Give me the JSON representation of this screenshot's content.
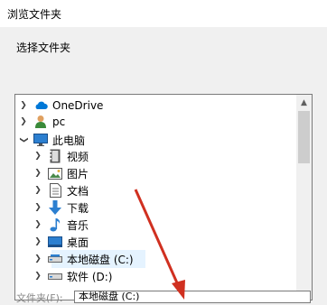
{
  "window": {
    "title": "浏览文件夹"
  },
  "dialog": {
    "instruction": "选择文件夹"
  },
  "tree": {
    "items": [
      {
        "label": "OneDrive",
        "icon": "onedrive-icon",
        "level": 0
      },
      {
        "label": "pc",
        "icon": "user-icon",
        "level": 0
      },
      {
        "label": "此电脑",
        "icon": "computer-icon",
        "level": 0,
        "expanded": true
      },
      {
        "label": "视频",
        "icon": "video-folder-icon",
        "level": 1
      },
      {
        "label": "图片",
        "icon": "pictures-folder-icon",
        "level": 1
      },
      {
        "label": "文档",
        "icon": "documents-folder-icon",
        "level": 1
      },
      {
        "label": "下载",
        "icon": "download-folder-icon",
        "level": 1
      },
      {
        "label": "音乐",
        "icon": "music-folder-icon",
        "level": 1
      },
      {
        "label": "桌面",
        "icon": "desktop-folder-icon",
        "level": 1
      },
      {
        "label": "本地磁盘 (C:)",
        "icon": "drive-icon",
        "level": 1,
        "selected": true
      },
      {
        "label": "软件 (D:)",
        "icon": "drive-icon",
        "level": 1
      }
    ]
  },
  "folder_field": {
    "label": "文件夹(F):",
    "value": "本地磁盘 (C:)"
  },
  "colors": {
    "accent": "#0078d7",
    "selection": "#e5f3ff",
    "arrow": "#d03020"
  }
}
